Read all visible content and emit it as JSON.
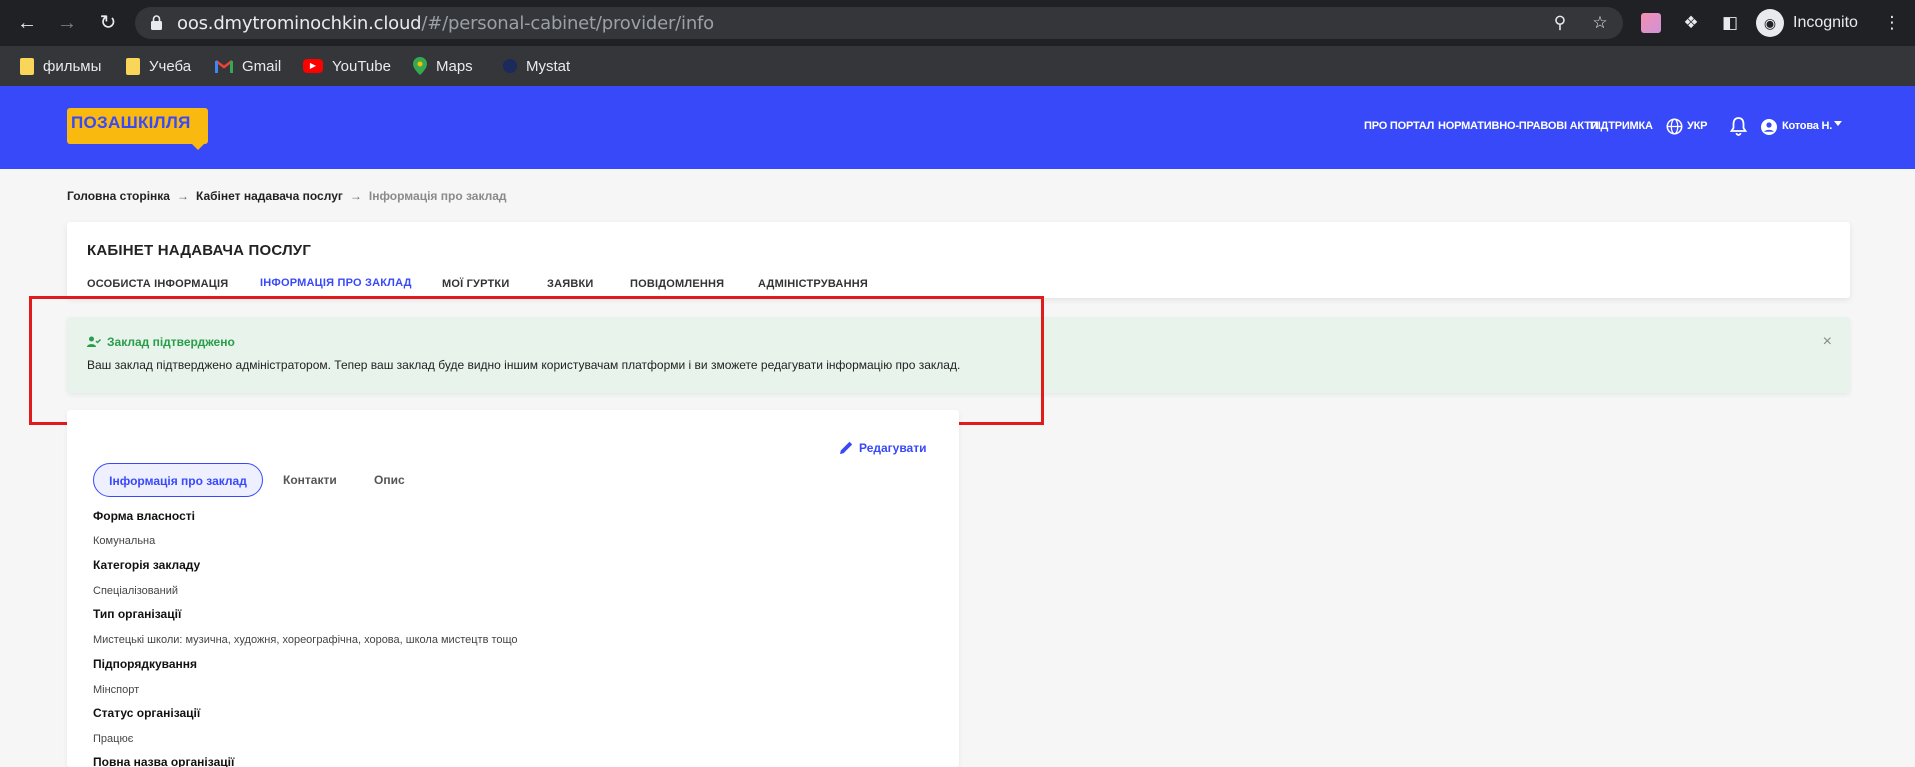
{
  "browser": {
    "url_host": "oos.dmytrominochkin.cloud",
    "url_path": "/#/personal-cabinet/provider/info",
    "profile_label": "Incognito",
    "bookmarks": [
      {
        "label": "фильмы",
        "icon": "folder-icon"
      },
      {
        "label": "Учеба",
        "icon": "folder-icon"
      },
      {
        "label": "Gmail",
        "icon": "gmail-icon"
      },
      {
        "label": "YouTube",
        "icon": "youtube-icon"
      },
      {
        "label": "Maps",
        "icon": "maps-icon"
      },
      {
        "label": "Mystat",
        "icon": "mystat-icon"
      }
    ]
  },
  "site": {
    "logo_text": "ПОЗАШКІЛЛЯ",
    "brand_color": "#3849f9",
    "logo_color": "#f9b90f",
    "nav": {
      "about": "ПРО ПОРТАЛ",
      "legal": "НОРМАТИВНО-ПРАВОВІ АКТИ",
      "support": "ПІДТРИМКА",
      "language": "УКР",
      "user": "Котова Н."
    }
  },
  "breadcrumb": {
    "home": "Головна сторінка",
    "cabinet": "Кабінет надавача послуг",
    "current": "Інформація про заклад"
  },
  "cabinet": {
    "title": "КАБІНЕТ НАДАВАЧА ПОСЛУГ",
    "tabs": {
      "personal": "ОСОБИСТА ІНФОРМАЦІЯ",
      "info": "ІНФОРМАЦІЯ ПРО ЗАКЛАД",
      "clubs": "МОЇ ГУРТКИ",
      "applications": "ЗАЯВКИ",
      "messages": "ПОВІДОМЛЕННЯ",
      "admin": "АДМІНІСТРУВАННЯ"
    },
    "active_tab": "info"
  },
  "alert": {
    "title": "Заклад підтверджено",
    "message": "Ваш заклад підтверджено адміністратором. Тепер ваш заклад буде видно іншим користувачам платформи і ви зможете редагувати інформацію про заклад.",
    "status_color": "#2a9d4a"
  },
  "panel": {
    "edit_label": "Редагувати",
    "tabs": {
      "info": "Інформація про заклад",
      "contacts": "Контакти",
      "description": "Опис"
    },
    "fields": [
      {
        "label": "Форма власності",
        "value": "Комунальна"
      },
      {
        "label": "Категорія закладу",
        "value": "Спеціалізований"
      },
      {
        "label": "Тип організації",
        "value": "Мистецькі школи: музична, художня, хореографічна, хорова, школа мистецтв тощо"
      },
      {
        "label": "Підпорядкування",
        "value": "Мінспорт"
      },
      {
        "label": "Статус організації",
        "value": "Працює"
      },
      {
        "label": "Повна назва організації",
        "value": ""
      }
    ]
  }
}
